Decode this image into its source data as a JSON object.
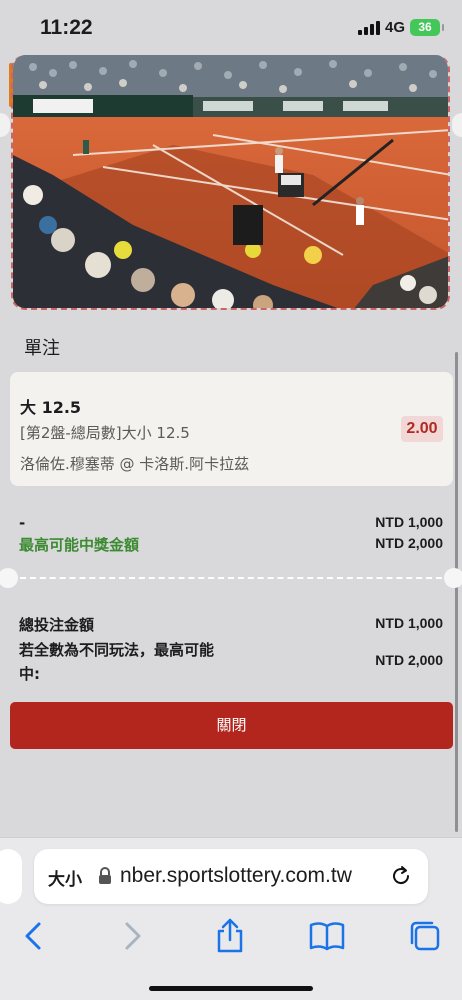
{
  "status_bar": {
    "time": "11:22",
    "network": "4G",
    "battery": "36"
  },
  "video": {
    "description_icon": "tennis-live-stream"
  },
  "bet_slip": {
    "title": "單注",
    "selection": "大 12.5",
    "market": "[第2盤-總局數]大小 12.5",
    "event": "洛倫佐.穆塞蒂 @ 卡洛斯.阿卡拉茲",
    "odds": "2.00"
  },
  "summary": {
    "dash": "-",
    "stake_value": "NTD 1,000",
    "max_win_label": "最高可能中獎金額",
    "max_win_value": "NTD 2,000",
    "total_stake_label": "總投注金額",
    "total_stake_value": "NTD 1,000",
    "total_win_label": "若全數為不同玩法，最高可能中:",
    "total_win_value": "NTD 2,000"
  },
  "close_button_label": "關閉",
  "browser": {
    "text_size_label": "大小",
    "url": "nber.sportslottery.com.tw"
  },
  "colors": {
    "accent_red": "#b3261e",
    "win_green": "#3c8a32",
    "odds_bg": "#f1d8d6"
  }
}
